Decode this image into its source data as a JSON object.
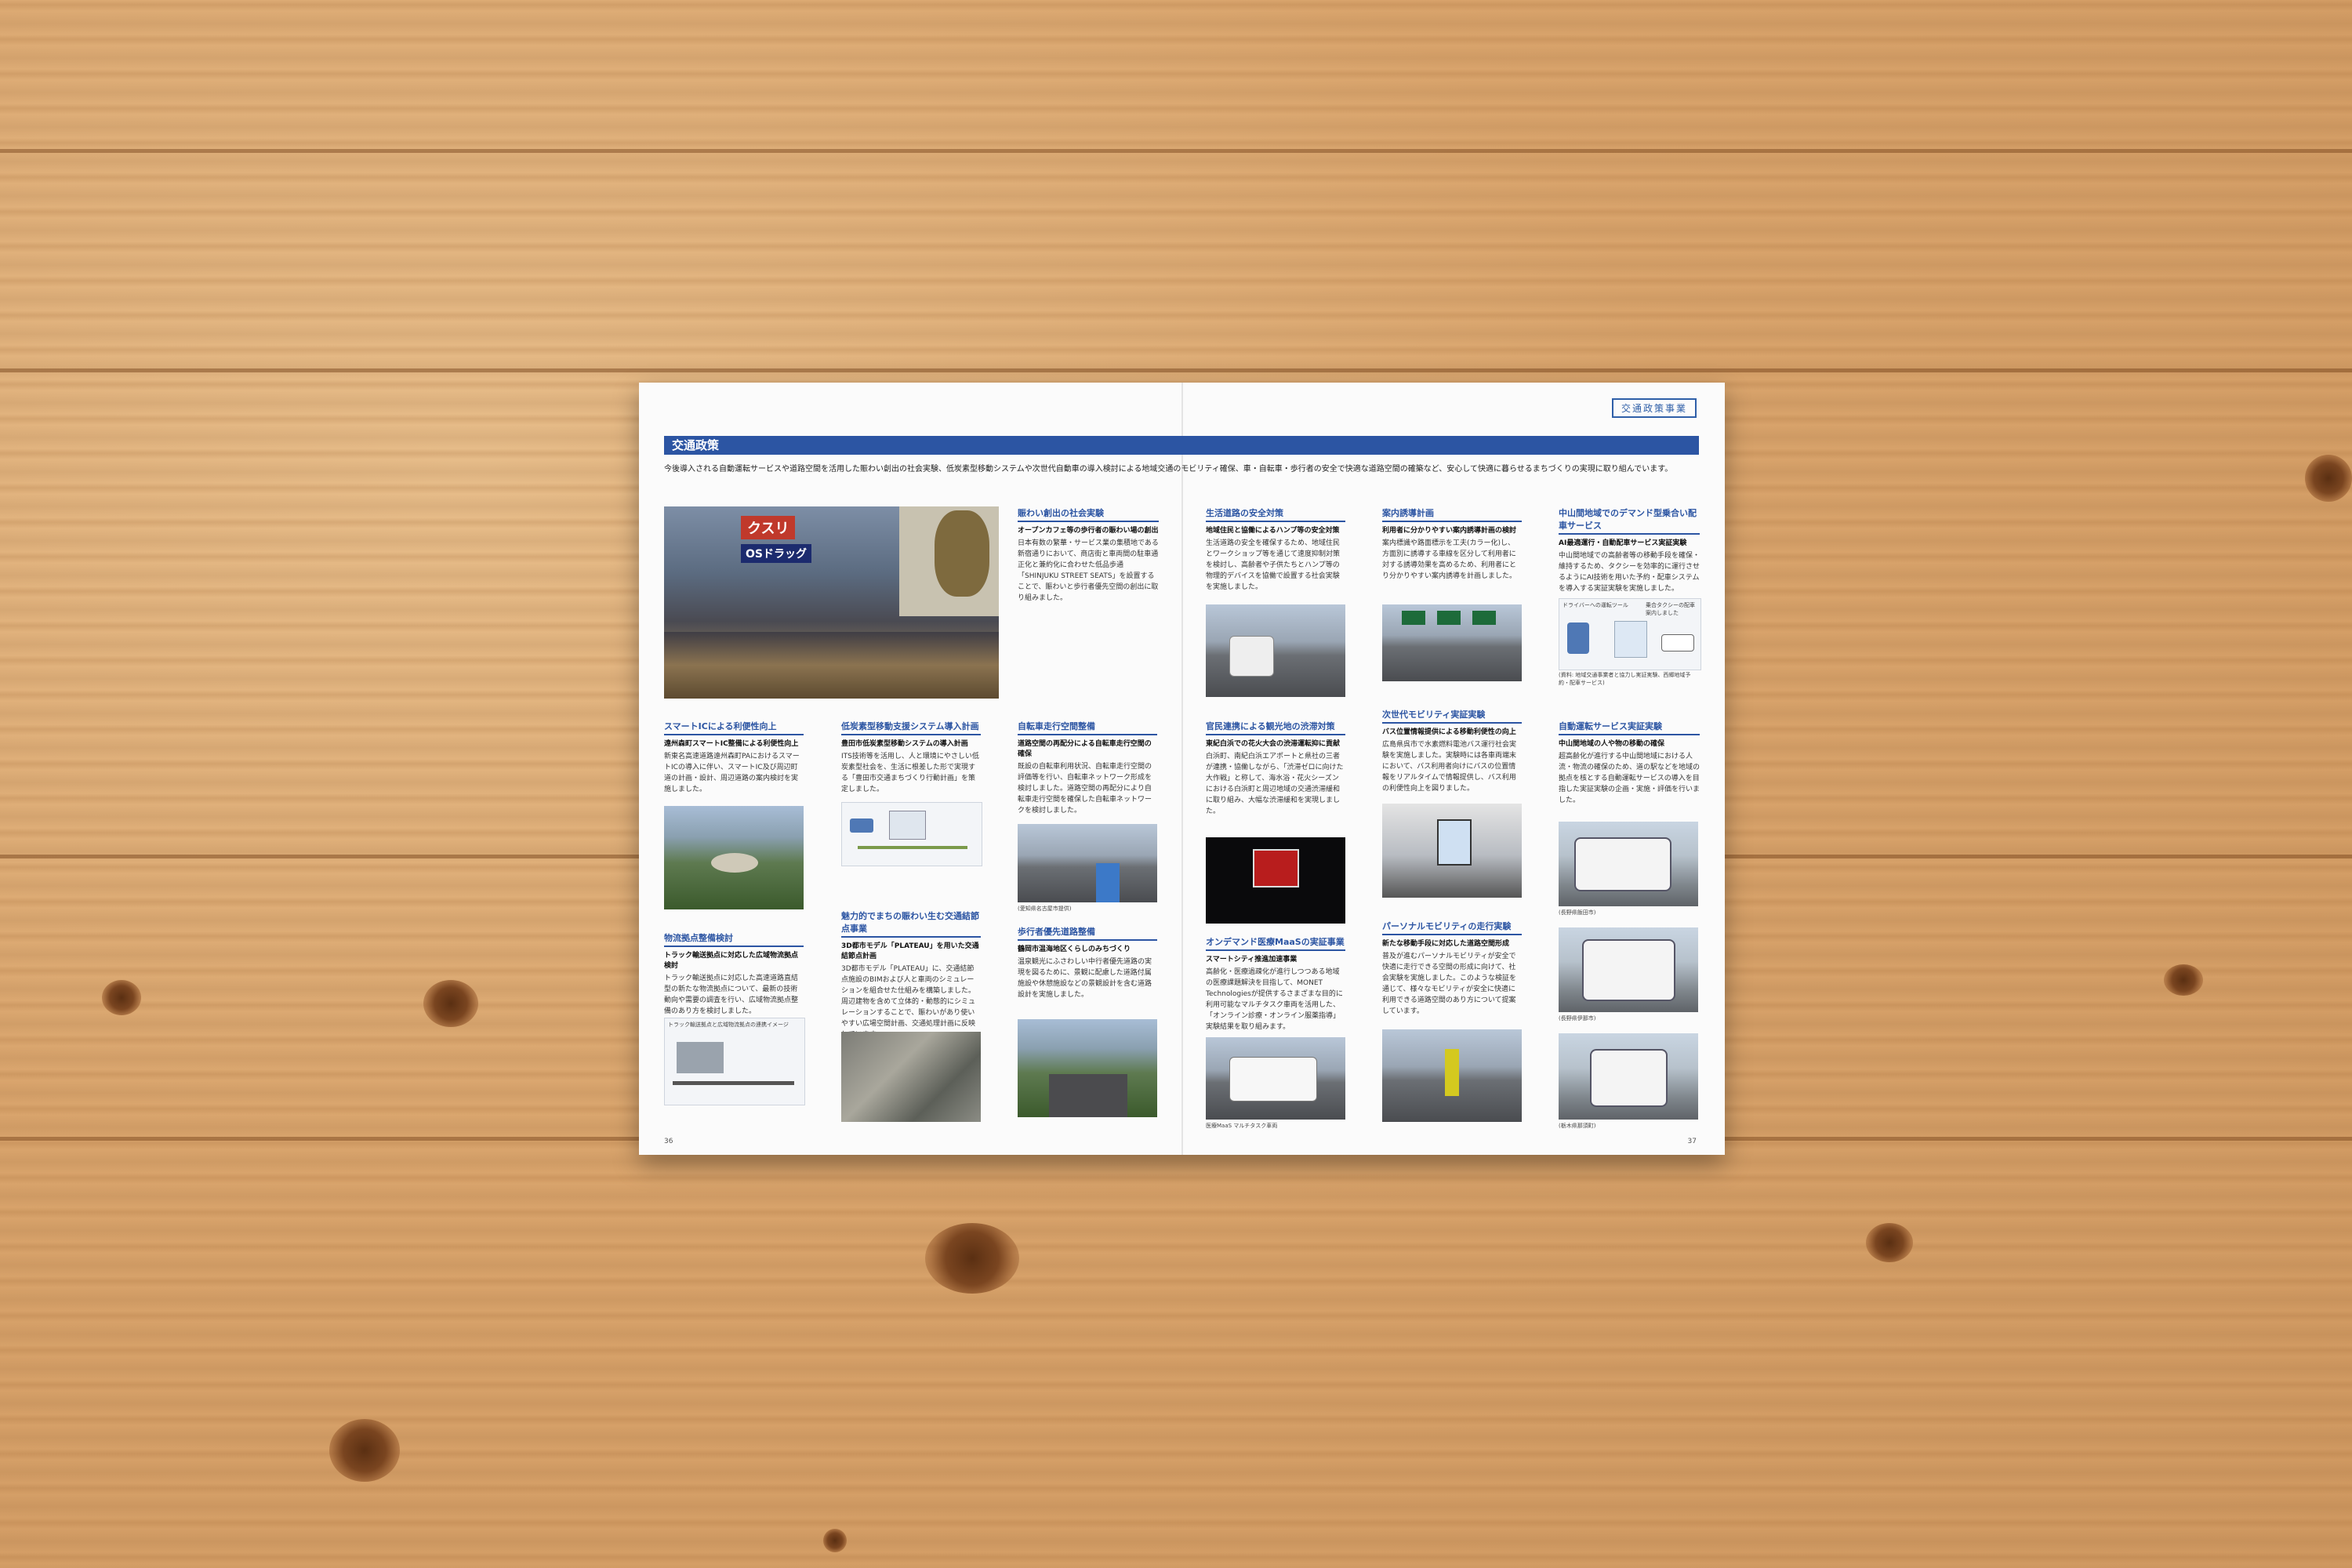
{
  "tag": "交通政策事業",
  "banner_title": "交通政策",
  "intro": "今後導入される自動運転サービスや道路空間を活用した賑わい創出の社会実験、低炭素型移動システムや次世代自動車の導入検討による地域交通のモビリティ確保、車・自転車・歩行者の安全で快適な道路空間の確築など、安心して快適に暮らせるまちづくりの実現に取り組んでいます。",
  "main_photo_signs": [
    "クスリ",
    "OSドラッグ"
  ],
  "articles": {
    "a1": {
      "title": "賑わい創出の社会実験",
      "subtitle": "オープンカフェ等の歩行者の賑わい場の創出",
      "body": "日本有数の繁華・サービス業の集積地である新宿通りにおいて、商店街と車両間の駐車通正化と兼約化に合わせた低品歩通「SHINJUKU STREET SEATS」を設置することで、賑わいと歩行者優先空間の創出に取り組みました。"
    },
    "a2": {
      "title": "生活道路の安全対策",
      "subtitle": "地域住民と協働によるハンプ等の安全対策",
      "body": "生活道路の安全を確保するため、地域住民とワークショップ等を通じて速度抑制対策を検討し、高齢者や子供たちとハンプ等の物理的デバイスを協働で設置する社会実験を実施しました。"
    },
    "a3": {
      "title": "案内誘導計画",
      "subtitle": "利用者に分かりやすい案内誘導計画の検討",
      "body": "案内標識や路面標示を工夫(カラー化)し、方面別に誘導する車線を区分して利用者に対する誘導効果を高めるため、利用者にとり分かりやすい案内誘導を計画しました。"
    },
    "a4": {
      "title": "中山間地域でのデマンド型乗合い配車サービス",
      "subtitle": "AI最適運行・自動配車サービス実証実験",
      "body": "中山間地域での高齢者等の移動手段を確保・維持するため、タクシーを効率的に運行させるようにAI技術を用いた予約・配車システムを導入する実証実験を実施しました。",
      "fig_labels": [
        "ドライバーへの運転ツール",
        "乗合タクシーの配車案内しました"
      ],
      "caption": "(資料: 地域交通事業者と協力し実証実験、西郷地域予約・配車サービス)"
    },
    "b1": {
      "title": "スマートICによる利便性向上",
      "subtitle": "遠州森町スマートIC整備による利便性向上",
      "body": "新東名高速道路遠州森町PAにおけるスマートICの導入に伴い、スマートIC及び周辺町道の計画・設計、周辺道路の案内検討を実施しました。"
    },
    "b2": {
      "title": "低炭素型移動支援システム導入計画",
      "subtitle": "豊田市低炭素型移動システムの導入計画",
      "body": "ITS技術等を活用し、人と環境にやさしい低炭素型社会を、生活に根差した形で実現する「豊田市交通まちづくり行動計画」を策定しました。"
    },
    "b3": {
      "title": "自転車走行空間整備",
      "subtitle": "道路空間の再配分による自転車走行空間の確保",
      "body": "既設の自転車利用状況、自転車走行空間の評価等を行い、自転車ネットワーク形成を検討しました。道路空間の再配分により自転車走行空間を確保した自転車ネットワークを検討しました。",
      "caption": "(愛知県名古屋市提供)"
    },
    "b4": {
      "title": "官民連携による観光地の渋滞対策",
      "subtitle": "東紀白浜での花火大会の渋滞運転抑に貢献",
      "body": "白浜町、南紀白浜エアポートと県社の三者が連携・協働しながら、「渋滞ゼロに向けた大作戦」と称して、海水浴・花火シーズンにおける白浜町と周辺地域の交通渋滞緩和に取り組み、大幅な渋滞緩和を実現しました。"
    },
    "b5": {
      "title": "次世代モビリティ実証実験",
      "subtitle": "バス位置情報提供による移動利便性の向上",
      "body": "広島県呉市で水素燃料電池バス運行社会実験を実施しました。実験時には各車両端末において、バス利用者向けにバスの位置情報をリアルタイムで情報提供し、バス利用の利便性向上を図りました。"
    },
    "b6": {
      "title": "自動運転サービス実証実験",
      "subtitle": "中山間地域の人や物の移動の確保",
      "body": "超高齢化が進行する中山間地域における人流・物流の確保のため、道の駅などを地域の拠点を核とする自動運転サービスの導入を目指した実証実験の企画・実施・評価を行いました。",
      "captions": [
        "(長野県飯田市)",
        "(長野県伊那市)",
        "(栃木県那須町)"
      ]
    },
    "c1": {
      "title": "物流拠点整備検討",
      "subtitle": "トラック輸送拠点に対応した広域物流拠点検討",
      "body": "トラック輸送拠点に対応した高速道路直結型の新たな物流拠点について、最新の技術動向や需要の調査を行い、広域物流拠点整備のあり方を検討しました。",
      "fig_title": "トラック輸送拠点と広域物流拠点の連携イメージ"
    },
    "c2": {
      "title": "魅力的でまちの賑わい生む交通結節点事業",
      "subtitle": "3D都市モデル「PLATEAU」を用いた交通結節点計画",
      "body": "3D都市モデル「PLATEAU」に、交通結節点施設のBIMおよび人と車両のシミュレーションを組合せた仕組みを構築しました。周辺建物を含めて立体的・動態的にシミュレーションすることで、賑わいがあり使いやすい広場空間計画、交通処理計画に反映しています。"
    },
    "c3": {
      "title": "歩行者優先道路整備",
      "subtitle": "鶴岡市温海地区くらしのみちづくり",
      "body": "温泉観光にふさわしい中行者優先道路の実現を図るために、景観に配慮した道路付属施設や休憩施設などの景観設計を含む道路設計を実施しました。"
    },
    "c4": {
      "title": "オンデマンド医療MaaSの実証事業",
      "subtitle": "スマートシティ推進加速事業",
      "body": "高齢化・医療過疎化が進行しつつある地域の医療課題解決を目指して、MONET Technologiesが提供するさまざまな目的に利用可能なマルチタスク車両を活用した、「オンライン診療・オンライン服薬指導」実験結果を取り組みます。",
      "caption": "医療MaaS マルチタスク車両"
    },
    "c5": {
      "title": "パーソナルモビリティの走行実験",
      "subtitle": "新たな移動手段に対応した道路空間形成",
      "body": "普及が進むパーソナルモビリティが安全で快適に走行できる空間の形成に向けて、社会実験を実施しました。このような検証を通じて、様々なモビリティが安全に快適に利用できる道路空間のあり方について提案しています。"
    }
  },
  "page_left": "36",
  "page_right": "37"
}
